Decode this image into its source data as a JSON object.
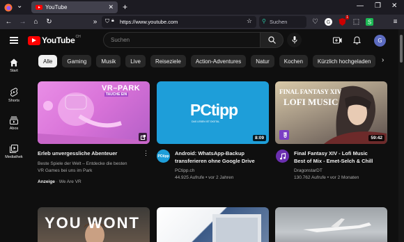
{
  "browser": {
    "tab_title": "YouTube",
    "url": "https://www.youtube.com",
    "search_placeholder": "Suchen",
    "notification_count": "1"
  },
  "youtube": {
    "logo_text": "YouTube",
    "country_code": "CH",
    "search_placeholder": "Suchen",
    "avatar_letter": "G"
  },
  "guide": [
    {
      "label": "Start",
      "icon": "home-icon"
    },
    {
      "label": "Shorts",
      "icon": "shorts-icon"
    },
    {
      "label": "Abos",
      "icon": "subscriptions-icon"
    },
    {
      "label": "Mediathek",
      "icon": "library-icon"
    }
  ],
  "chips": [
    "Alle",
    "Gaming",
    "Musik",
    "Live",
    "Reiseziele",
    "Action-Adventures",
    "Natur",
    "Kochen",
    "Kürzlich hochgeladen"
  ],
  "videos": [
    {
      "title_line1": "Erleb unvergessliche Abenteuer",
      "title_line2": "",
      "desc_line1": "Beste Spiele der Welt – Entdecke die besten",
      "desc_line2": "VR Games bei uns im Park",
      "ad_label": "Anzeige",
      "ad_channel": "· We Are VR",
      "thumb_text1": "VR–PARK",
      "thumb_text2": "TAUCHE EIN"
    },
    {
      "title_line1": "Android: WhatsApp-Backup",
      "title_line2": "transferieren ohne Google Drive",
      "channel": "PCtipp.ch",
      "stats": "44.925 Aufrufe • vor 2 Jahren",
      "duration": "8:09",
      "thumb_text": "PCtipp",
      "thumb_sub": "DAS LEBEN IST DIGITAL",
      "avatar_text": "PCtipp"
    },
    {
      "title_line1": "Final Fantasy XIV - Lofi Music",
      "title_line2": "Best of Mix - Emet-Selch & Chill",
      "channel": "DragonstarDT",
      "stats": "130.762 Aufrufe • vor 2 Monaten",
      "duration": "59:42",
      "thumb_text1": "FINAL FANTASY XIV",
      "thumb_text2": "LOFI MUSIC"
    }
  ],
  "row2": {
    "thumb1_text": "YOU WONT"
  }
}
